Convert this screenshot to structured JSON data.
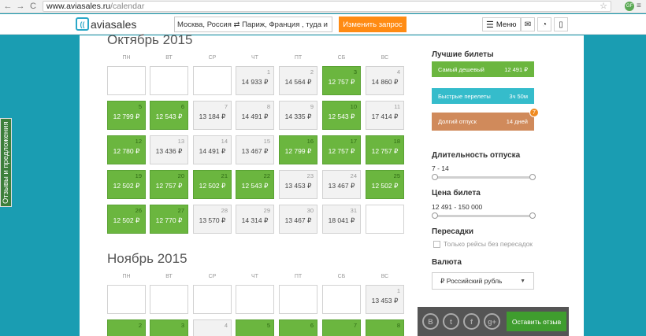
{
  "browser": {
    "url_host": "www.aviasales.ru",
    "url_path": "/calendar",
    "back_glyph": "←",
    "forward_glyph": "→",
    "reload_glyph": "C",
    "star_glyph": "☆",
    "extension_initials": "GF",
    "menu_glyph": "≡"
  },
  "header": {
    "logo_text": "aviasales",
    "logo_mark": "((",
    "search_value": "Москва, Россия ⇄ Париж, Франция , туда и обрат...",
    "change_button": "Изменить запрос",
    "menu_label": "Меню",
    "menu_glyph": "☰",
    "icons": [
      {
        "name": "mail-icon",
        "glyph": "✉"
      },
      {
        "name": "rss-icon",
        "glyph": "◔"
      },
      {
        "name": "mobile-icon",
        "glyph": "▯"
      }
    ]
  },
  "feedback_tab": "Отзывы и предложения",
  "weekdays": [
    "ПН",
    "ВТ",
    "СР",
    "ЧТ",
    "ПТ",
    "СБ",
    "ВС"
  ],
  "months": [
    {
      "title": "Октябрь 2015",
      "cells": [
        {
          "day": "",
          "price": "",
          "state": "empty"
        },
        {
          "day": "",
          "price": "",
          "state": "empty"
        },
        {
          "day": "",
          "price": "",
          "state": "empty"
        },
        {
          "day": "1",
          "price": "14 933 ₽",
          "state": "gray"
        },
        {
          "day": "2",
          "price": "14 564 ₽",
          "state": "gray"
        },
        {
          "day": "3",
          "price": "12 757 ₽",
          "state": "green"
        },
        {
          "day": "4",
          "price": "14 860 ₽",
          "state": "gray"
        },
        {
          "day": "5",
          "price": "12 799 ₽",
          "state": "green"
        },
        {
          "day": "6",
          "price": "12 543 ₽",
          "state": "green"
        },
        {
          "day": "7",
          "price": "13 184 ₽",
          "state": "gray"
        },
        {
          "day": "8",
          "price": "14 491 ₽",
          "state": "gray"
        },
        {
          "day": "9",
          "price": "14 335 ₽",
          "state": "gray"
        },
        {
          "day": "10",
          "price": "12 543 ₽",
          "state": "green"
        },
        {
          "day": "11",
          "price": "17 414 ₽",
          "state": "gray"
        },
        {
          "day": "12",
          "price": "12 780 ₽",
          "state": "green"
        },
        {
          "day": "13",
          "price": "13 436 ₽",
          "state": "gray"
        },
        {
          "day": "14",
          "price": "14 491 ₽",
          "state": "gray"
        },
        {
          "day": "15",
          "price": "13 467 ₽",
          "state": "gray"
        },
        {
          "day": "16",
          "price": "12 799 ₽",
          "state": "green"
        },
        {
          "day": "17",
          "price": "12 757 ₽",
          "state": "green"
        },
        {
          "day": "18",
          "price": "12 757 ₽",
          "state": "green"
        },
        {
          "day": "19",
          "price": "12 502 ₽",
          "state": "green"
        },
        {
          "day": "20",
          "price": "12 757 ₽",
          "state": "green"
        },
        {
          "day": "21",
          "price": "12 502 ₽",
          "state": "green"
        },
        {
          "day": "22",
          "price": "12 543 ₽",
          "state": "green"
        },
        {
          "day": "23",
          "price": "13 453 ₽",
          "state": "gray"
        },
        {
          "day": "24",
          "price": "13 467 ₽",
          "state": "gray"
        },
        {
          "day": "25",
          "price": "12 502 ₽",
          "state": "green"
        },
        {
          "day": "26",
          "price": "12 502 ₽",
          "state": "green"
        },
        {
          "day": "27",
          "price": "12 770 ₽",
          "state": "green"
        },
        {
          "day": "28",
          "price": "13 570 ₽",
          "state": "gray"
        },
        {
          "day": "29",
          "price": "14 314 ₽",
          "state": "gray"
        },
        {
          "day": "30",
          "price": "13 467 ₽",
          "state": "gray"
        },
        {
          "day": "31",
          "price": "18 041 ₽",
          "state": "gray"
        },
        {
          "day": "",
          "price": "",
          "state": "empty"
        }
      ]
    },
    {
      "title": "Ноябрь 2015",
      "cells": [
        {
          "day": "",
          "price": "",
          "state": "empty"
        },
        {
          "day": "",
          "price": "",
          "state": "empty"
        },
        {
          "day": "",
          "price": "",
          "state": "empty"
        },
        {
          "day": "",
          "price": "",
          "state": "empty"
        },
        {
          "day": "",
          "price": "",
          "state": "empty"
        },
        {
          "day": "",
          "price": "",
          "state": "empty"
        },
        {
          "day": "1",
          "price": "13 453 ₽",
          "state": "gray"
        },
        {
          "day": "2",
          "price": "",
          "state": "green"
        },
        {
          "day": "3",
          "price": "",
          "state": "green"
        },
        {
          "day": "4",
          "price": "",
          "state": "gray"
        },
        {
          "day": "5",
          "price": "",
          "state": "green"
        },
        {
          "day": "6",
          "price": "",
          "state": "green"
        },
        {
          "day": "7",
          "price": "",
          "state": "green"
        },
        {
          "day": "8",
          "price": "",
          "state": "green"
        }
      ]
    }
  ],
  "panel": {
    "best_title": "Лучшие билеты",
    "best": [
      {
        "label": "Самый дешевый",
        "value": "12 491 ₽"
      },
      {
        "label": "Быстрые перелеты",
        "value": "3ч 50м"
      },
      {
        "label": "Долгий отпуск",
        "value": "14 дней"
      }
    ],
    "best_badge": "7",
    "duration_title": "Длительность отпуска",
    "duration_range": "7 - 14",
    "price_title": "Цена билета",
    "price_range": "12 491 - 150 000",
    "stops_title": "Пересадки",
    "stops_checkbox": "Только рейсы без пересадок",
    "currency_title": "Валюта",
    "currency_value": "₽ Российский рубль",
    "currency_arrow": "▼"
  },
  "widget": {
    "social": [
      {
        "name": "vk-icon",
        "glyph": "B"
      },
      {
        "name": "twitter-icon",
        "glyph": "t"
      },
      {
        "name": "facebook-icon",
        "glyph": "f"
      },
      {
        "name": "google-plus-icon",
        "glyph": "g+"
      }
    ],
    "button": "Оставить отзыв"
  },
  "colors": {
    "teal_background": "#1a9db2",
    "cheap_green": "#6bb63f",
    "accent_orange": "#ff8b13"
  }
}
